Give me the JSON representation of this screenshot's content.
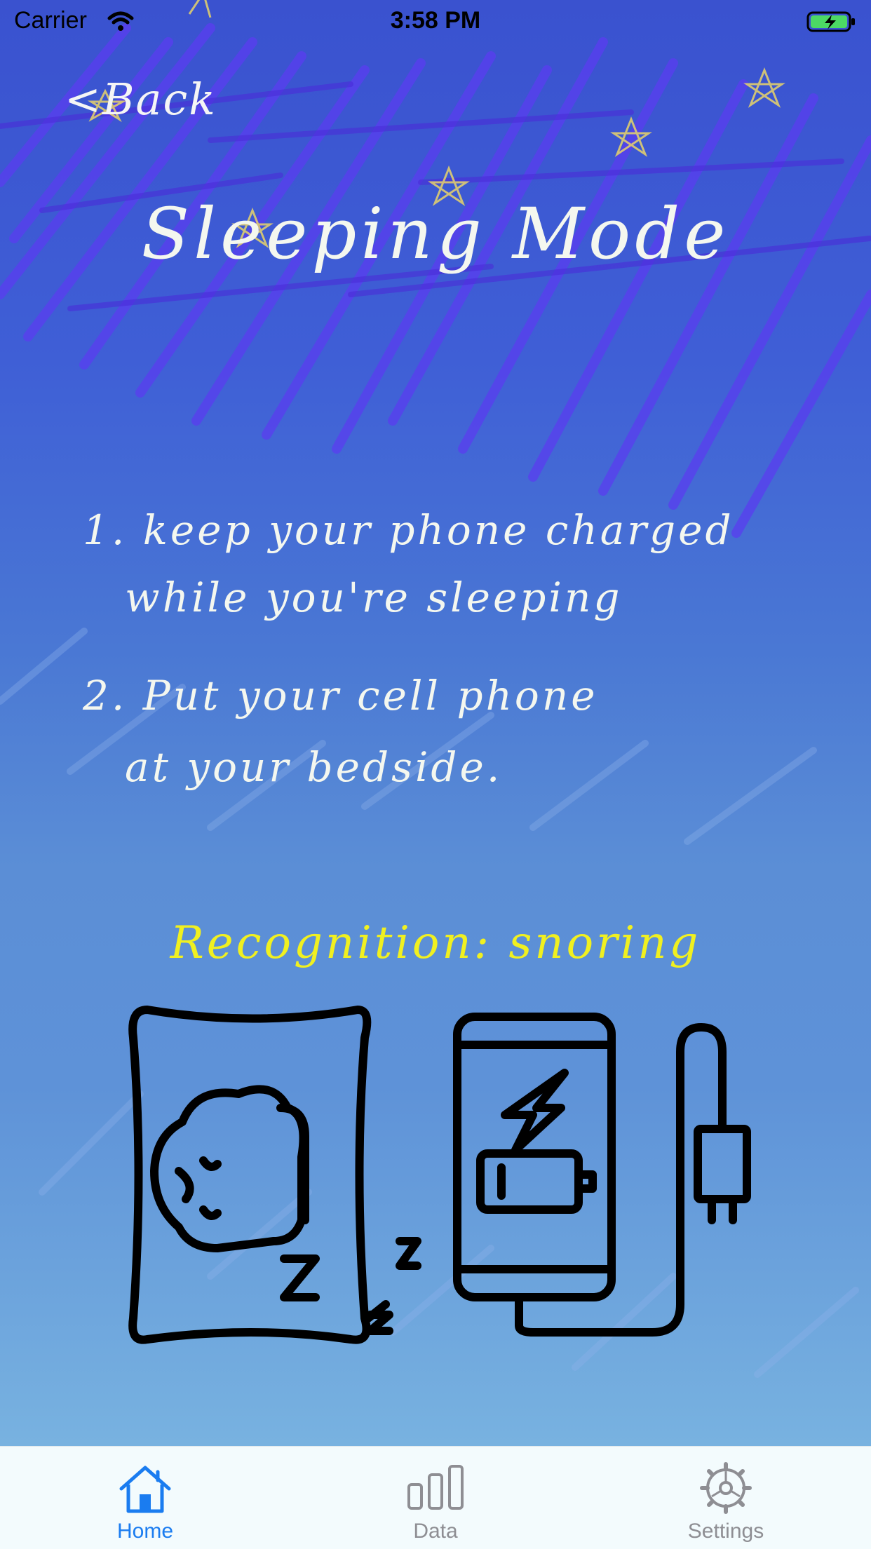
{
  "status_bar": {
    "carrier": "Carrier",
    "time": "3:58 PM"
  },
  "nav": {
    "back_label": "<Back"
  },
  "title": "Sleeping Mode",
  "instructions": {
    "step1_line1": "1. keep your phone charged",
    "step1_line2": "while you're sleeping",
    "step2_line1": "2. Put your cell phone",
    "step2_line2": "at your bedside."
  },
  "recognition_text": "Recognition: snoring",
  "illustration": {
    "left_icon": "sleeping-person-icon",
    "right_icon": "phone-charging-icon"
  },
  "tab_bar": {
    "tabs": [
      {
        "label": "Home",
        "icon": "home-icon",
        "selected": true
      },
      {
        "label": "Data",
        "icon": "bar-chart-icon",
        "selected": false
      },
      {
        "label": "Settings",
        "icon": "gear-icon",
        "selected": false
      }
    ]
  },
  "colors": {
    "active_tab": "#1a7cf0",
    "inactive_tab": "#8e8e93",
    "recognition_text": "#f0f020",
    "title_text": "#f4f7ef"
  }
}
